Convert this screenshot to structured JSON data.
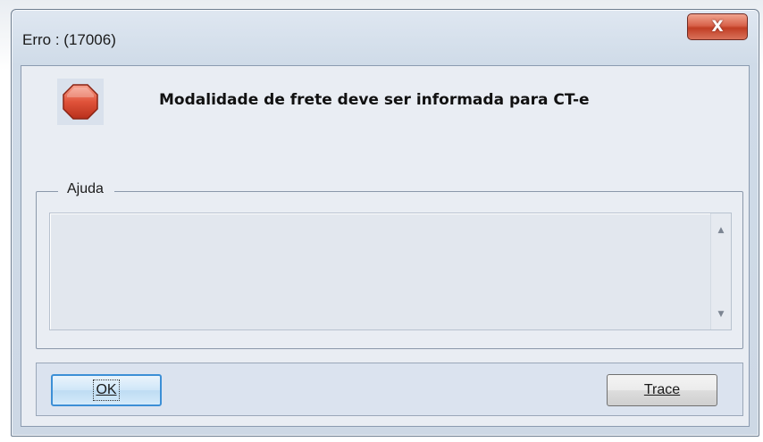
{
  "dialog": {
    "title": "Erro : (17006)",
    "close_label": "X",
    "message": "Modalidade de frete deve ser informada para CT-e"
  },
  "help": {
    "legend": "Ajuda",
    "content": ""
  },
  "buttons": {
    "ok_label": "OK",
    "trace_label": "Trace"
  },
  "icons": {
    "error": "stop-icon",
    "scroll_up": "scroll-up-arrow-icon",
    "scroll_down": "scroll-down-arrow-icon"
  },
  "colors": {
    "stop_icon": "#e0533a",
    "close_button": "#c9432b",
    "ok_border": "#3c8fd6"
  }
}
